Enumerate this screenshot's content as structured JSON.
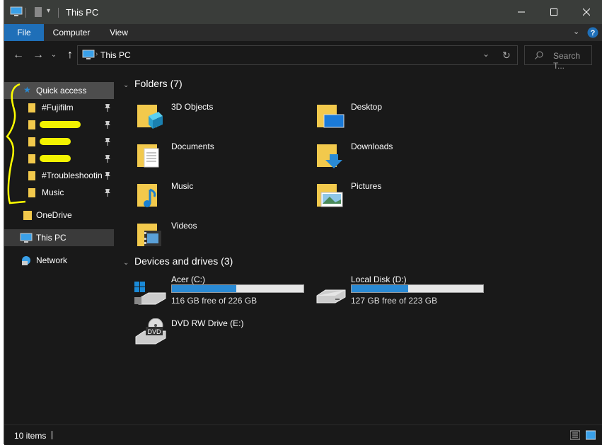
{
  "window": {
    "title": "This PC",
    "controls": [
      "minimize-icon",
      "maximize-icon",
      "close-icon"
    ]
  },
  "ribbon": {
    "tabs": [
      "File",
      "Computer",
      "View"
    ]
  },
  "address": {
    "breadcrumb": "This PC",
    "search_placeholder": "Search T..."
  },
  "sidebar": {
    "quick_access": "Quick access",
    "pinned": [
      {
        "label": "#Fujifilm",
        "redacted": false
      },
      {
        "label": "",
        "redacted": true
      },
      {
        "label": "",
        "redacted": true
      },
      {
        "label": "",
        "redacted": true
      },
      {
        "label": "#Troubleshootin",
        "redacted": false
      },
      {
        "label": "Music",
        "redacted": false
      }
    ],
    "onedrive": "OneDrive",
    "this_pc": "This PC",
    "network": "Network"
  },
  "folders": {
    "header": "Folders (7)",
    "items": [
      "3D Objects",
      "Desktop",
      "Documents",
      "Downloads",
      "Music",
      "Pictures",
      "Videos"
    ]
  },
  "drives": {
    "header": "Devices and drives (3)",
    "items": [
      {
        "name": "Acer (C:)",
        "free_text": "116 GB free of 226 GB",
        "used_fraction": 0.487
      },
      {
        "name": "Local Disk (D:)",
        "free_text": "127 GB free of 223 GB",
        "used_fraction": 0.43
      },
      {
        "name": "DVD RW Drive (E:)",
        "dvd_label": "DVD"
      }
    ]
  },
  "status": {
    "items_count": "10 items"
  },
  "colors": {
    "accent": "#1f6fb8",
    "folder": "#f2c94c",
    "annotation": "#ffff00"
  }
}
